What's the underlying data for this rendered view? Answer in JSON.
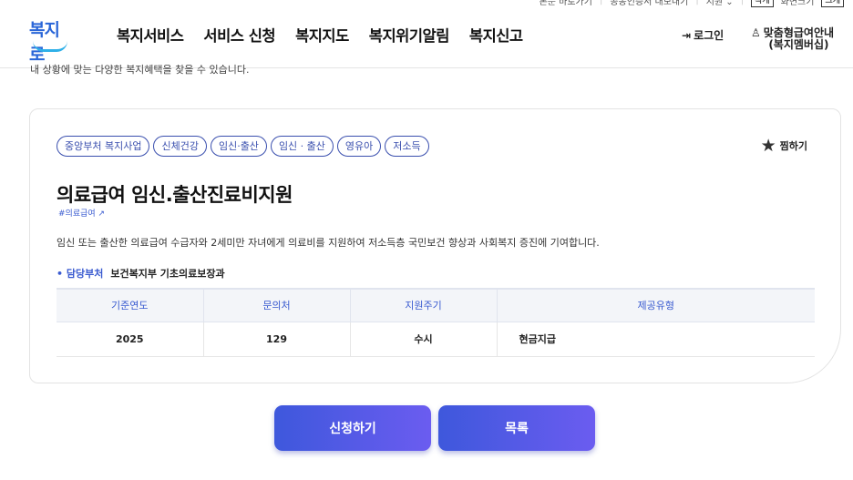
{
  "util_nav": {
    "skip": "본문 바로가기",
    "cert": "공동인증서 내보내기",
    "lang": "지원",
    "font_small": "작게",
    "font_zoom": "화면크기",
    "font_large": "크게"
  },
  "header": {
    "logo_text": "복지로",
    "nav": [
      "복지서비스",
      "서비스 신청",
      "복지지도",
      "복지위기알림",
      "복지신고"
    ],
    "login": "로그인",
    "custom_line1": "맞춤형급여안내",
    "custom_line2": "(복지멤버십)"
  },
  "intro": "내 상황에 맞는 다양한 복지혜택을 찾을 수 있습니다.",
  "card": {
    "tags": [
      "중앙부처 복지사업",
      "신체건강",
      "임신·출산",
      "임신 · 출산",
      "영유아",
      "저소득"
    ],
    "bookmark": "찜하기",
    "title": "의료급여 임신.출산진료비지원",
    "hashtag": "#의료급여",
    "description": "임신 또는 출산한 의료급여 수급자와 2세미만 자녀에게 의료비를 지원하여 저소득층 국민보건 향상과 사회복지 증진에 기여합니다.",
    "dept_label": "담당부처",
    "dept_value": "보건복지부 기초의료보장과",
    "table": {
      "headers": [
        "기준연도",
        "문의처",
        "지원주기",
        "제공유형"
      ],
      "row": [
        "2025",
        "129",
        "수시",
        "현금지급"
      ]
    }
  },
  "buttons": {
    "apply": "신청하기",
    "list": "목록"
  }
}
